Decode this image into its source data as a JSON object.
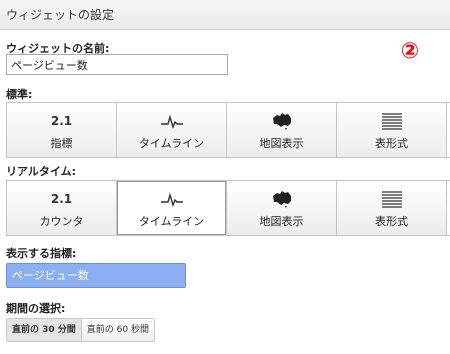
{
  "title": "ウィジェットの設定",
  "marker": "②",
  "name_section": {
    "label": "ウィジェットの名前:",
    "value": "ページビュー数"
  },
  "standard": {
    "label": "標準:",
    "buttons": [
      {
        "icon_text": "2.1",
        "label": "指標"
      },
      {
        "icon": "timeline-icon",
        "label": "タイムライン"
      },
      {
        "icon": "map-icon",
        "label": "地図表示"
      },
      {
        "icon": "table-icon",
        "label": "表形式"
      }
    ]
  },
  "realtime": {
    "label": "リアルタイム:",
    "selected": "タイムライン",
    "buttons": [
      {
        "icon_text": "2.1",
        "label": "カウンタ"
      },
      {
        "icon": "timeline-icon",
        "label": "タイムライン"
      },
      {
        "icon": "map-icon",
        "label": "地図表示"
      },
      {
        "icon": "table-icon",
        "label": "表形式"
      }
    ]
  },
  "metric": {
    "label": "表示する指標:",
    "value": "ページビュー数"
  },
  "period": {
    "label": "期間の選択:",
    "options": [
      "直前の 30 分間",
      "直前の 60 秒間"
    ],
    "selected": "直前の 30 分間"
  },
  "colors": {
    "marker": "#ff0000",
    "metric_bg": "#8caef3"
  }
}
